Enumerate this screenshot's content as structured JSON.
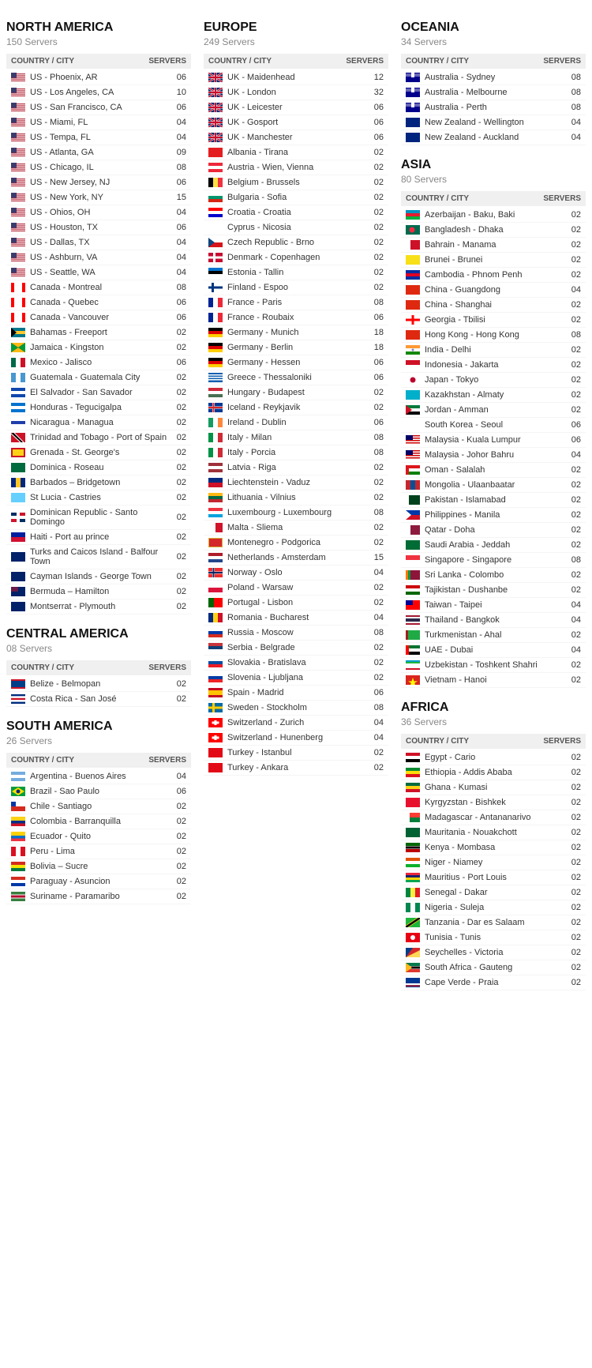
{
  "regions": {
    "northAmerica": {
      "title": "NORTH AMERICA",
      "servers": "150 Servers",
      "header": {
        "city": "COUNTRY / CITY",
        "servers": "SERVERS"
      },
      "rows": [
        {
          "flag": "us",
          "name": "US - Phoenix, AR",
          "count": "06"
        },
        {
          "flag": "us",
          "name": "US - Los Angeles, CA",
          "count": "10"
        },
        {
          "flag": "us",
          "name": "US - San Francisco, CA",
          "count": "06"
        },
        {
          "flag": "us",
          "name": "US - Miami, FL",
          "count": "04"
        },
        {
          "flag": "us",
          "name": "US - Tempa, FL",
          "count": "04"
        },
        {
          "flag": "us",
          "name": "US - Atlanta, GA",
          "count": "09"
        },
        {
          "flag": "us",
          "name": "US - Chicago, IL",
          "count": "08"
        },
        {
          "flag": "us",
          "name": "US - New Jersey, NJ",
          "count": "06"
        },
        {
          "flag": "us",
          "name": "US - New York, NY",
          "count": "15"
        },
        {
          "flag": "us",
          "name": "US - Ohios, OH",
          "count": "04"
        },
        {
          "flag": "us",
          "name": "US - Houston, TX",
          "count": "06"
        },
        {
          "flag": "us",
          "name": "US - Dallas, TX",
          "count": "04"
        },
        {
          "flag": "us",
          "name": "US - Ashburn, VA",
          "count": "04"
        },
        {
          "flag": "us",
          "name": "US - Seattle, WA",
          "count": "04"
        },
        {
          "flag": "ca",
          "name": "Canada - Montreal",
          "count": "08"
        },
        {
          "flag": "ca",
          "name": "Canada - Quebec",
          "count": "06"
        },
        {
          "flag": "ca",
          "name": "Canada - Vancouver",
          "count": "06"
        },
        {
          "flag": "bs",
          "name": "Bahamas - Freeport",
          "count": "02"
        },
        {
          "flag": "jm",
          "name": "Jamaica - Kingston",
          "count": "02"
        },
        {
          "flag": "mx",
          "name": "Mexico - Jalisco",
          "count": "06"
        },
        {
          "flag": "gt",
          "name": "Guatemala - Guatemala City",
          "count": "02"
        },
        {
          "flag": "sv",
          "name": "El Salvador - San Savador",
          "count": "02"
        },
        {
          "flag": "hn",
          "name": "Honduras - Tegucigalpa",
          "count": "02"
        },
        {
          "flag": "ni",
          "name": "Nicaragua - Managua",
          "count": "02"
        },
        {
          "flag": "tt",
          "name": "Trinidad and Tobago - Port of Spain",
          "count": "02"
        },
        {
          "flag": "gd",
          "name": "Grenada - St. George's",
          "count": "02"
        },
        {
          "flag": "dm",
          "name": "Dominica - Roseau",
          "count": "02"
        },
        {
          "flag": "bb",
          "name": "Barbados – Bridgetown",
          "count": "02"
        },
        {
          "flag": "lc",
          "name": "St Lucia - Castries",
          "count": "02"
        },
        {
          "flag": "do",
          "name": "Dominican Republic - Santo Domingo",
          "count": "02"
        },
        {
          "flag": "ht",
          "name": "Haiti - Port au prince",
          "count": "02"
        },
        {
          "flag": "tc",
          "name": "Turks and Caicos Island - Balfour Town",
          "count": "02"
        },
        {
          "flag": "ky",
          "name": "Cayman Islands - George Town",
          "count": "02"
        },
        {
          "flag": "bm",
          "name": "Bermuda – Hamilton",
          "count": "02"
        },
        {
          "flag": "ms",
          "name": "Montserrat - Plymouth",
          "count": "02"
        }
      ]
    },
    "centralAmerica": {
      "title": "CENTRAL AMERICA",
      "servers": "08 Servers",
      "header": {
        "city": "COUNTRY / CITY",
        "servers": "SERVERS"
      },
      "rows": [
        {
          "flag": "bz",
          "name": "Belize - Belmopan",
          "count": "02"
        },
        {
          "flag": "cr",
          "name": "Costa Rica - San José",
          "count": "02"
        }
      ]
    },
    "southAmerica": {
      "title": "SOUTH AMERICA",
      "servers": "26 Servers",
      "header": {
        "city": "COUNTRY / CITY",
        "servers": "SERVERS"
      },
      "rows": [
        {
          "flag": "ar",
          "name": "Argentina - Buenos Aires",
          "count": "04"
        },
        {
          "flag": "br",
          "name": "Brazil - Sao Paulo",
          "count": "06"
        },
        {
          "flag": "cl",
          "name": "Chile - Santiago",
          "count": "02"
        },
        {
          "flag": "co",
          "name": "Colombia - Barranquilla",
          "count": "02"
        },
        {
          "flag": "ec",
          "name": "Ecuador - Quito",
          "count": "02"
        },
        {
          "flag": "pe",
          "name": "Peru - Lima",
          "count": "02"
        },
        {
          "flag": "bo",
          "name": "Bolivia – Sucre",
          "count": "02"
        },
        {
          "flag": "py",
          "name": "Paraguay - Asuncion",
          "count": "02"
        },
        {
          "flag": "sr",
          "name": "Suriname - Paramaribo",
          "count": "02"
        }
      ]
    },
    "europe": {
      "title": "EUROPE",
      "servers": "249 Servers",
      "header": {
        "city": "COUNTRY / CITY",
        "servers": "SERVERS"
      },
      "rows": [
        {
          "flag": "gb",
          "name": "UK - Maidenhead",
          "count": "12"
        },
        {
          "flag": "gb",
          "name": "UK - London",
          "count": "32"
        },
        {
          "flag": "gb",
          "name": "UK - Leicester",
          "count": "06"
        },
        {
          "flag": "gb",
          "name": "UK - Gosport",
          "count": "06"
        },
        {
          "flag": "gb",
          "name": "UK - Manchester",
          "count": "06"
        },
        {
          "flag": "al",
          "name": "Albania - Tirana",
          "count": "02"
        },
        {
          "flag": "at",
          "name": "Austria - Wien, Vienna",
          "count": "02"
        },
        {
          "flag": "be",
          "name": "Belgium - Brussels",
          "count": "02"
        },
        {
          "flag": "bg",
          "name": "Bulgaria - Sofia",
          "count": "02"
        },
        {
          "flag": "hr",
          "name": "Croatia - Croatia",
          "count": "02"
        },
        {
          "flag": "cy",
          "name": "Cyprus - Nicosia",
          "count": "02"
        },
        {
          "flag": "cz",
          "name": "Czech Republic - Brno",
          "count": "02"
        },
        {
          "flag": "dk",
          "name": "Denmark - Copenhagen",
          "count": "02"
        },
        {
          "flag": "ee",
          "name": "Estonia - Tallin",
          "count": "02"
        },
        {
          "flag": "fi",
          "name": "Finland - Espoo",
          "count": "02"
        },
        {
          "flag": "fr",
          "name": "France - Paris",
          "count": "08"
        },
        {
          "flag": "fr",
          "name": "France - Roubaix",
          "count": "06"
        },
        {
          "flag": "de",
          "name": "Germany - Munich",
          "count": "18"
        },
        {
          "flag": "de",
          "name": "Germany - Berlin",
          "count": "18"
        },
        {
          "flag": "de",
          "name": "Germany - Hessen",
          "count": "06"
        },
        {
          "flag": "gr",
          "name": "Greece - Thessaloniki",
          "count": "06"
        },
        {
          "flag": "hu",
          "name": "Hungary - Budapest",
          "count": "02"
        },
        {
          "flag": "is",
          "name": "Iceland - Reykjavik",
          "count": "02"
        },
        {
          "flag": "ie",
          "name": "Ireland - Dublin",
          "count": "06"
        },
        {
          "flag": "it",
          "name": "Italy - Milan",
          "count": "08"
        },
        {
          "flag": "it",
          "name": "Italy - Porcia",
          "count": "08"
        },
        {
          "flag": "lv",
          "name": "Latvia - Riga",
          "count": "02"
        },
        {
          "flag": "li",
          "name": "Liechtenstein - Vaduz",
          "count": "02"
        },
        {
          "flag": "lt",
          "name": "Lithuania - Vilnius",
          "count": "02"
        },
        {
          "flag": "lu",
          "name": "Luxembourg - Luxembourg",
          "count": "08"
        },
        {
          "flag": "mt",
          "name": "Malta - Sliema",
          "count": "02"
        },
        {
          "flag": "me",
          "name": "Montenegro - Podgorica",
          "count": "02"
        },
        {
          "flag": "nl",
          "name": "Netherlands - Amsterdam",
          "count": "15"
        },
        {
          "flag": "no",
          "name": "Norway - Oslo",
          "count": "04"
        },
        {
          "flag": "pl",
          "name": "Poland - Warsaw",
          "count": "02"
        },
        {
          "flag": "pt",
          "name": "Portugal - Lisbon",
          "count": "02"
        },
        {
          "flag": "ro",
          "name": "Romania - Bucharest",
          "count": "04"
        },
        {
          "flag": "ru",
          "name": "Russia - Moscow",
          "count": "08"
        },
        {
          "flag": "rs",
          "name": "Serbia - Belgrade",
          "count": "02"
        },
        {
          "flag": "sk",
          "name": "Slovakia - Bratislava",
          "count": "02"
        },
        {
          "flag": "si",
          "name": "Slovenia - Ljubljana",
          "count": "02"
        },
        {
          "flag": "es",
          "name": "Spain - Madrid",
          "count": "06"
        },
        {
          "flag": "se",
          "name": "Sweden - Stockholm",
          "count": "08"
        },
        {
          "flag": "ch",
          "name": "Switzerland - Zurich",
          "count": "04"
        },
        {
          "flag": "ch",
          "name": "Switzerland - Hunenberg",
          "count": "04"
        },
        {
          "flag": "tr",
          "name": "Turkey - Istanbul",
          "count": "02"
        },
        {
          "flag": "tr",
          "name": "Turkey - Ankara",
          "count": "02"
        }
      ]
    },
    "oceania": {
      "title": "OCEANIA",
      "servers": "34 Servers",
      "header": {
        "city": "COUNTRY / CITY",
        "servers": "SERVERS"
      },
      "rows": [
        {
          "flag": "au",
          "name": "Australia - Sydney",
          "count": "08"
        },
        {
          "flag": "au",
          "name": "Australia - Melbourne",
          "count": "08"
        },
        {
          "flag": "au",
          "name": "Australia - Perth",
          "count": "08"
        },
        {
          "flag": "nz",
          "name": "New Zealand - Wellington",
          "count": "04"
        },
        {
          "flag": "nz",
          "name": "New Zealand - Auckland",
          "count": "04"
        }
      ]
    },
    "asia": {
      "title": "ASIA",
      "servers": "80 Servers",
      "header": {
        "city": "COUNTRY / CITY",
        "servers": "SERVERS"
      },
      "rows": [
        {
          "flag": "az",
          "name": "Azerbaijan - Baku, Baki",
          "count": "02"
        },
        {
          "flag": "bd",
          "name": "Bangladesh - Dhaka",
          "count": "02"
        },
        {
          "flag": "bh",
          "name": "Bahrain - Manama",
          "count": "02"
        },
        {
          "flag": "bn",
          "name": "Brunei - Brunei",
          "count": "02"
        },
        {
          "flag": "kh",
          "name": "Cambodia - Phnom Penh",
          "count": "02"
        },
        {
          "flag": "cn",
          "name": "China - Guangdong",
          "count": "04"
        },
        {
          "flag": "cn",
          "name": "China - Shanghai",
          "count": "02"
        },
        {
          "flag": "ge",
          "name": "Georgia - Tbilisi",
          "count": "02"
        },
        {
          "flag": "hk",
          "name": "Hong Kong - Hong Kong",
          "count": "08"
        },
        {
          "flag": "in",
          "name": "India - Delhi",
          "count": "02"
        },
        {
          "flag": "id",
          "name": "Indonesia - Jakarta",
          "count": "02"
        },
        {
          "flag": "jp",
          "name": "Japan - Tokyo",
          "count": "02"
        },
        {
          "flag": "kz",
          "name": "Kazakhstan - Almaty",
          "count": "02"
        },
        {
          "flag": "jo",
          "name": "Jordan - Amman",
          "count": "02"
        },
        {
          "flag": "kr",
          "name": "South Korea - Seoul",
          "count": "06"
        },
        {
          "flag": "my",
          "name": "Malaysia - Kuala Lumpur",
          "count": "06"
        },
        {
          "flag": "my",
          "name": "Malaysia - Johor Bahru",
          "count": "04"
        },
        {
          "flag": "om",
          "name": "Oman - Salalah",
          "count": "02"
        },
        {
          "flag": "mn",
          "name": "Mongolia - Ulaanbaatar",
          "count": "02"
        },
        {
          "flag": "pk",
          "name": "Pakistan - Islamabad",
          "count": "02"
        },
        {
          "flag": "ph",
          "name": "Philippines - Manila",
          "count": "02"
        },
        {
          "flag": "qa",
          "name": "Qatar - Doha",
          "count": "02"
        },
        {
          "flag": "sa",
          "name": "Saudi Arabia - Jeddah",
          "count": "02"
        },
        {
          "flag": "sg",
          "name": "Singapore - Singapore",
          "count": "08"
        },
        {
          "flag": "lk",
          "name": "Sri Lanka - Colombo",
          "count": "02"
        },
        {
          "flag": "tj",
          "name": "Tajikistan - Dushanbe",
          "count": "02"
        },
        {
          "flag": "tw",
          "name": "Taiwan - Taipei",
          "count": "04"
        },
        {
          "flag": "th",
          "name": "Thailand - Bangkok",
          "count": "04"
        },
        {
          "flag": "tm",
          "name": "Turkmenistan - Ahal",
          "count": "02"
        },
        {
          "flag": "ae",
          "name": "UAE - Dubai",
          "count": "04"
        },
        {
          "flag": "uz",
          "name": "Uzbekistan - Toshkent Shahri",
          "count": "02"
        },
        {
          "flag": "vn",
          "name": "Vietnam - Hanoi",
          "count": "02"
        }
      ]
    },
    "africa": {
      "title": "AFRICA",
      "servers": "36 Servers",
      "header": {
        "city": "COUNTRY / CITY",
        "servers": "SERVERS"
      },
      "rows": [
        {
          "flag": "eg",
          "name": "Egypt - Cario",
          "count": "02"
        },
        {
          "flag": "et",
          "name": "Ethiopia - Addis Ababa",
          "count": "02"
        },
        {
          "flag": "gh",
          "name": "Ghana - Kumasi",
          "count": "02"
        },
        {
          "flag": "kg",
          "name": "Kyrgyzstan - Bishkek",
          "count": "02"
        },
        {
          "flag": "mg",
          "name": "Madagascar - Antananarivo",
          "count": "02"
        },
        {
          "flag": "mr",
          "name": "Mauritania - Nouakchott",
          "count": "02"
        },
        {
          "flag": "ke",
          "name": "Kenya - Mombasa",
          "count": "02"
        },
        {
          "flag": "ne",
          "name": "Niger - Niamey",
          "count": "02"
        },
        {
          "flag": "mu",
          "name": "Mauritius - Port Louis",
          "count": "02"
        },
        {
          "flag": "sn",
          "name": "Senegal - Dakar",
          "count": "02"
        },
        {
          "flag": "ng",
          "name": "Nigeria - Suleja",
          "count": "02"
        },
        {
          "flag": "tz",
          "name": "Tanzania - Dar es Salaam",
          "count": "02"
        },
        {
          "flag": "tn",
          "name": "Tunisia - Tunis",
          "count": "02"
        },
        {
          "flag": "sc",
          "name": "Seychelles - Victoria",
          "count": "02"
        },
        {
          "flag": "za",
          "name": "South Africa - Gauteng",
          "count": "02"
        },
        {
          "flag": "cv",
          "name": "Cape Verde - Praia",
          "count": "02"
        }
      ]
    }
  },
  "flagColors": {
    "us": [
      "#B22234",
      "#fff",
      "#3C3B6E"
    ],
    "ca": [
      "#FF0000",
      "#fff"
    ],
    "gb": [
      "#012169",
      "#C8102E",
      "#fff"
    ],
    "de": [
      "#000",
      "#D00",
      "#FFCE00"
    ],
    "fr": [
      "#002395",
      "#fff",
      "#ED2939"
    ],
    "au": [
      "#00008B",
      "#fff",
      "#FF0000"
    ],
    "nz": [
      "#00247D",
      "#fff",
      "#CC142B"
    ],
    "default": [
      "#aaa",
      "#ddd"
    ]
  }
}
